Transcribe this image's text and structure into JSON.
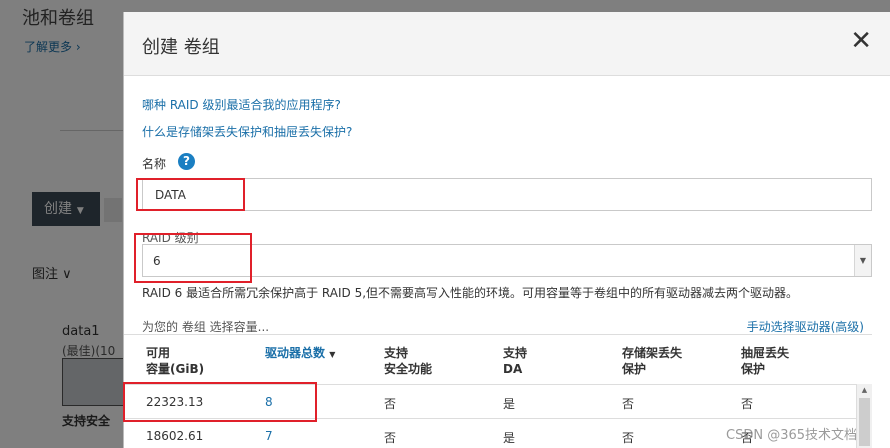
{
  "background": {
    "title": "池和卷组",
    "learn_more": "了解更多 ›",
    "create_button": "创建",
    "legend": "图注",
    "legend_chevron": "∨",
    "volume_group_name": "data1",
    "best_label": "(最佳)(10",
    "secure_label": "支持安全"
  },
  "dialog": {
    "title": "创建 卷组",
    "close_glyph": "✕",
    "help_links": [
      "哪种 RAID 级别最适合我的应用程序?",
      "什么是存储架丢失保护和抽屉丢失保护?"
    ],
    "name_label": "名称",
    "help_icon_glyph": "?",
    "name_value": "DATA",
    "raid_label": "RAID 级别",
    "raid_value": "6",
    "raid_description": "RAID 6 最适合所需冗余保护高于 RAID 5,但不需要高写入性能的环境。可用容量等于卷组中的所有驱动器减去两个驱动器。",
    "choose_caption": "为您的 卷组 选择容量...",
    "manual_link": "手动选择驱动器(高级)",
    "table": {
      "headers": [
        {
          "line1": "可用",
          "line2": "容量(GiB)"
        },
        {
          "line1": "驱动器总数",
          "line2": "",
          "sort": "▼"
        },
        {
          "line1": "支持",
          "line2": "安全功能"
        },
        {
          "line1": "支持",
          "line2": "DA"
        },
        {
          "line1": "存储架丢失",
          "line2": "保护"
        },
        {
          "line1": "抽屉丢失",
          "line2": "保护"
        }
      ],
      "rows": [
        {
          "capacity": "22323.13",
          "drives": "8",
          "secure": "否",
          "da": "是",
          "shelf": "否",
          "drawer": "否"
        },
        {
          "capacity": "18602.61",
          "drives": "7",
          "secure": "否",
          "da": "是",
          "shelf": "否",
          "drawer": "否"
        }
      ]
    }
  },
  "watermark": "CSDN @365技术文档",
  "colors": {
    "link": "#1a6fa8",
    "highlight_box": "#e0202a",
    "help_icon": "#1b7fc2"
  }
}
